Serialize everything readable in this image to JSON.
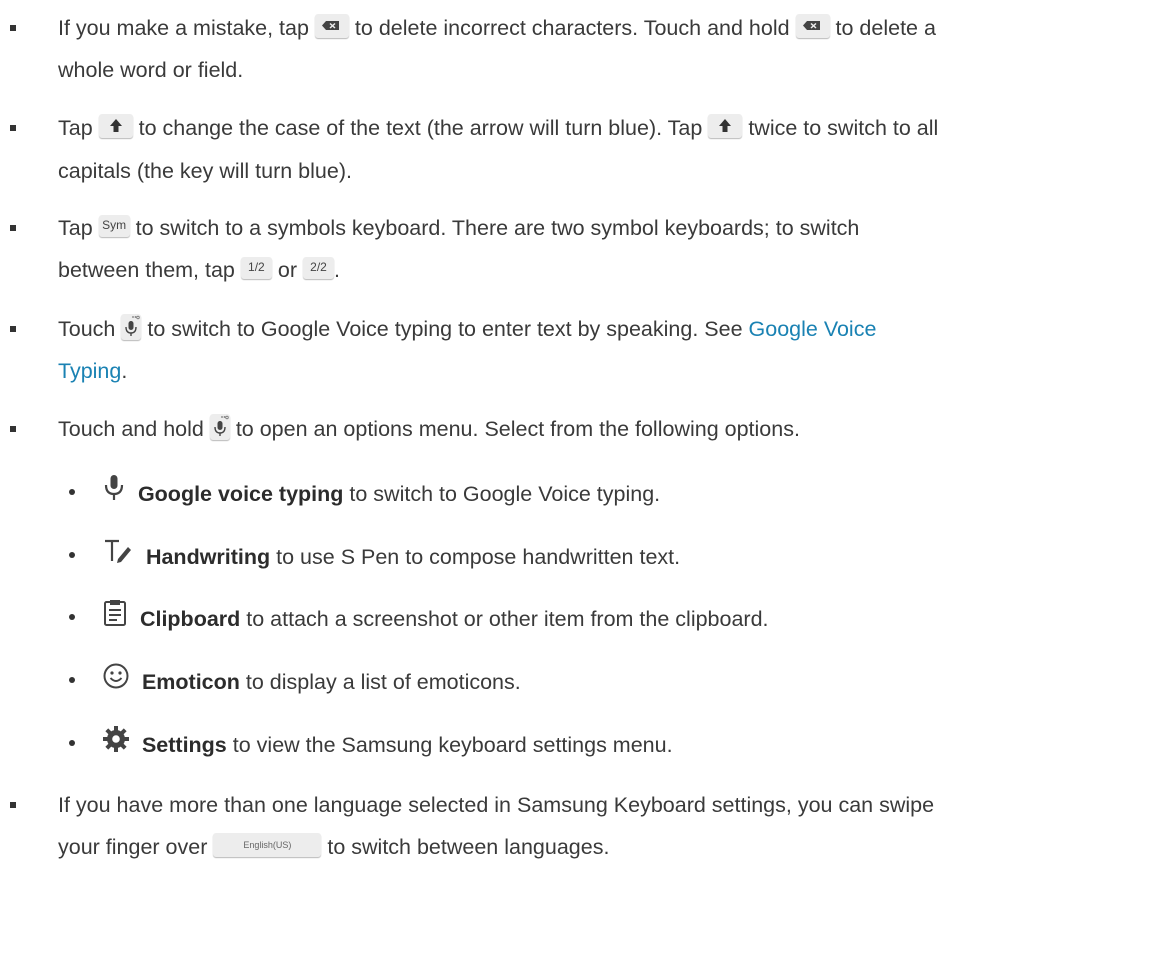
{
  "bullets": [
    {
      "line1": [
        "If you make a mistake, tap",
        "to delete incorrect characters. Touch and hold",
        "to delete a"
      ],
      "line2": "whole word or field."
    },
    {
      "line1": [
        "Tap",
        "to change the case of the text (the arrow will turn blue). Tap",
        "twice to switch to all"
      ],
      "line2": "capitals (the key will turn blue)."
    },
    {
      "line1": [
        "Tap",
        "to switch to a symbols keyboard. There are two symbol keyboards; to switch"
      ],
      "line2": [
        "between them, tap",
        "or",
        "."
      ],
      "keys": {
        "sym": "Sym",
        "half1": "1/2",
        "half2": "2/2"
      }
    },
    {
      "line1": [
        "Touch",
        "to switch to Google Voice typing to enter text by speaking. See",
        "Google Voice"
      ],
      "line2": [
        "Typing",
        "."
      ]
    },
    {
      "line1": [
        "Touch and hold",
        "to open an options menu. Select from the following options."
      ]
    },
    {
      "line1": "If you have more than one language selected in Samsung Keyboard settings, you can swipe",
      "line2": [
        "your finger over",
        "to switch between languages."
      ],
      "lang_key": "English(US)"
    }
  ],
  "options": [
    {
      "icon": "microphone-icon",
      "label": "Google voice typing",
      "desc": "to switch to Google Voice typing."
    },
    {
      "icon": "handwriting-icon",
      "label": "Handwriting",
      "desc": "to use S Pen to compose handwritten text."
    },
    {
      "icon": "clipboard-icon",
      "label": "Clipboard",
      "desc": "to attach a screenshot or other item from the clipboard."
    },
    {
      "icon": "emoticon-icon",
      "label": "Emoticon",
      "desc": "to display a list of emoticons."
    },
    {
      "icon": "gear-icon",
      "label": "Settings",
      "desc": "to view the Samsung keyboard settings menu."
    }
  ],
  "colors": {
    "text": "#3a3a3a",
    "link": "#1a82b3",
    "key_bg": "#ededed"
  }
}
